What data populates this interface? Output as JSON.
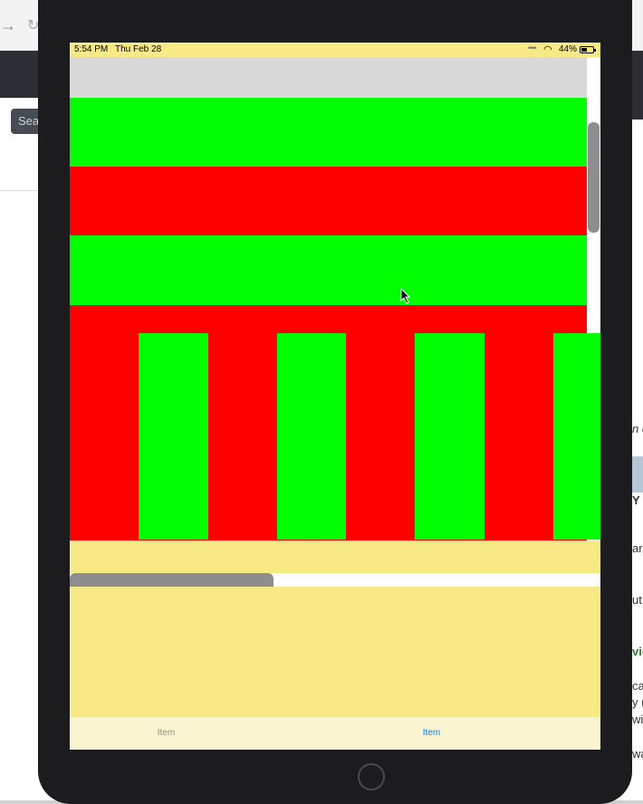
{
  "background": {
    "search_label": "Search",
    "fragments": [
      "n c",
      "Y",
      "ar",
      "ut",
      "vie",
      "ca",
      "y (",
      "wi",
      "wa"
    ]
  },
  "status_bar": {
    "time": "5:54 PM",
    "date": "Thu Feb 28",
    "battery": "44%"
  },
  "colors": {
    "green": "#00ff00",
    "red": "#ff0000",
    "yellow": "#f7ea86",
    "tab_active": "#0a7aff",
    "tab_inactive": "#8e8e8e"
  },
  "vertical_rows": [
    "gray",
    "green",
    "red",
    "green",
    "red"
  ],
  "horizontal_columns": [
    "red",
    "green",
    "red",
    "green",
    "red",
    "green",
    "red",
    "green"
  ],
  "tab_bar": {
    "items": [
      {
        "label": "Item",
        "selected": false
      },
      {
        "label": "Item",
        "selected": true
      }
    ]
  }
}
